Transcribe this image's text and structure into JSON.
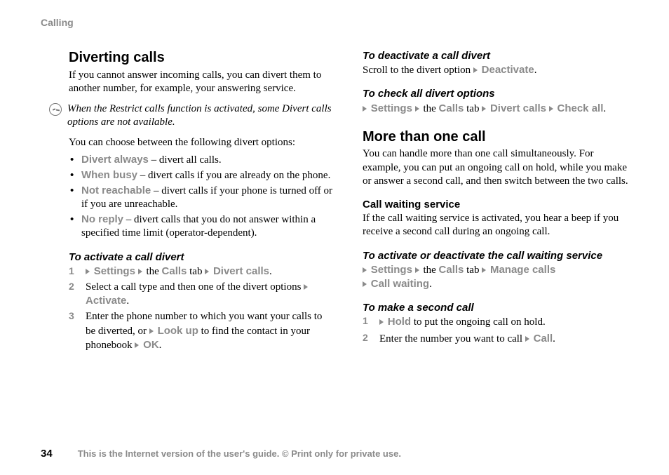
{
  "header": {
    "section": "Calling"
  },
  "left": {
    "h1": "Diverting calls",
    "intro": "If you cannot answer incoming calls, you can divert them to another number, for example, your answering service.",
    "note": "When the Restrict calls function is activated, some Divert calls options are not available.",
    "options_intro": "You can choose between the following divert options:",
    "options": {
      "always": {
        "label": "Divert always",
        "desc": " – divert all calls."
      },
      "busy": {
        "label": "When busy",
        "desc": " – divert calls if you are already on the phone."
      },
      "unreach": {
        "label": "Not reachable",
        "desc": " – divert calls if your phone is turned off or if you are unreachable."
      },
      "noreply": {
        "label": "No reply",
        "desc": " – divert calls that you do not answer within a specified time limit (operator-dependent)."
      }
    },
    "activate": {
      "title": "To activate a call divert",
      "s1": {
        "settings": "Settings",
        "the": " the ",
        "calls": "Calls",
        "tabword": " tab ",
        "divert": "Divert calls",
        "period": "."
      },
      "s2": {
        "pre": "Select a call type and then one of the divert options ",
        "activate": "Activate",
        "period": "."
      },
      "s3": {
        "pre": "Enter the phone number to which you want your calls to be diverted, or ",
        "lookup": "Look up",
        "mid": " to find the contact in your phonebook ",
        "ok": "OK",
        "period": "."
      }
    }
  },
  "right": {
    "deact": {
      "title": "To deactivate a call divert",
      "pre": " Scroll to the divert option ",
      "deactivate": "Deactivate",
      "period": "."
    },
    "check": {
      "title": "To check all divert options",
      "settings": "Settings",
      "the": " the ",
      "calls": "Calls",
      "tabword": " tab ",
      "divert": "Divert calls",
      "checkall": "Check all",
      "period": "."
    },
    "more": {
      "title": "More than one call",
      "body": "You can handle more than one call simultaneously. For example, you can put an ongoing call on hold, while you make or answer a second call, and then switch between the two calls."
    },
    "waiting": {
      "title": "Call waiting service",
      "body": "If the call waiting service is activated, you hear a beep if you receive a second call during an ongoing call."
    },
    "waitact": {
      "title": "To activate or deactivate the call waiting service",
      "settings": "Settings",
      "the": " the ",
      "calls": "Calls",
      "tabword": " tab ",
      "manage": "Manage calls",
      "callwaiting": "Call waiting",
      "period": "."
    },
    "second": {
      "title": "To make a second call",
      "s1": {
        "hold": "Hold",
        "rest": " to put the ongoing call on hold."
      },
      "s2": {
        "pre": "Enter the number you want to call ",
        "call": "Call",
        "period": "."
      }
    }
  },
  "footer": {
    "page": "34",
    "text": "This is the Internet version of the user's guide. © Print only for private use."
  }
}
